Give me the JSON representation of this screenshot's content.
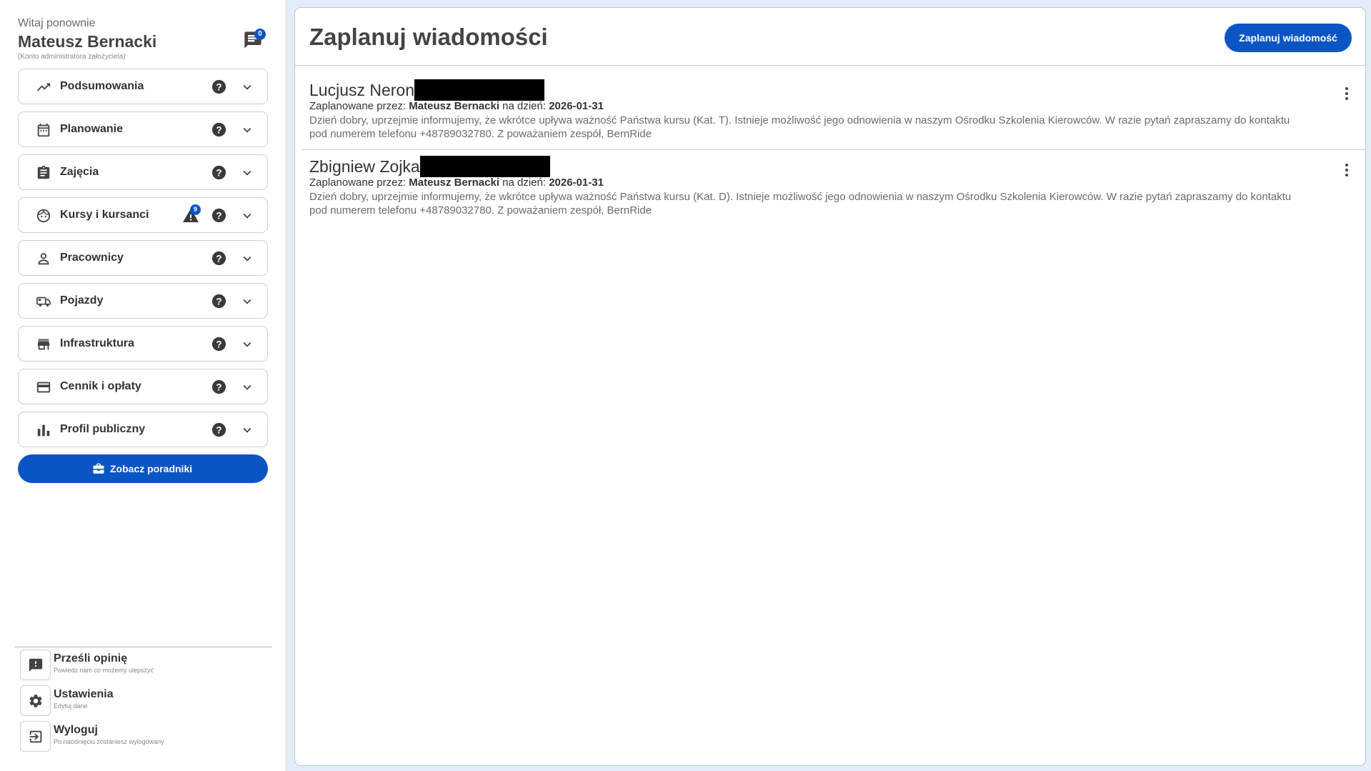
{
  "user": {
    "greeting": "Witaj ponownie",
    "name": "Mateusz Bernacki",
    "account_type": "(Konto administratora założyciela)",
    "messages_count": "0"
  },
  "menu": [
    {
      "label": "Podsumowania",
      "icon": "trending-up-icon"
    },
    {
      "label": "Planowanie",
      "icon": "calendar-icon"
    },
    {
      "label": "Zajęcia",
      "icon": "clipboard-icon"
    },
    {
      "label": "Kursy i kursanci",
      "icon": "face-icon",
      "warning_count": "9"
    },
    {
      "label": "Pracownicy",
      "icon": "person-icon"
    },
    {
      "label": "Pojazdy",
      "icon": "vehicle-icon"
    },
    {
      "label": "Infrastruktura",
      "icon": "store-icon"
    },
    {
      "label": "Cennik i opłaty",
      "icon": "credit-card-icon"
    },
    {
      "label": "Profil publiczny",
      "icon": "bar-chart-icon"
    }
  ],
  "guides_button": "Zobacz poradniki",
  "bottom": [
    {
      "title": "Prześli opinię",
      "subtitle": "Powiedz nam co możemy ulepszyć",
      "icon": "feedback-icon"
    },
    {
      "title": "Ustawienia",
      "subtitle": "Edytuj dane",
      "icon": "gear-icon"
    },
    {
      "title": "Wyloguj",
      "subtitle": "Po naciśnięciu zostaniesz wylogowany",
      "icon": "logout-icon"
    }
  ],
  "main": {
    "title": "Zaplanuj wiadomości",
    "schedule_button": "Zaplanuj wiadomość",
    "scheduled_by_label": "Zaplanowane przez:",
    "on_day_label": "na dzień:",
    "messages": [
      {
        "recipient": "Lucjusz Neron",
        "author": "Mateusz Bernacki",
        "date": "2026-01-31",
        "text": "Dzień dobry, uprzejmie informujemy, że wkrótce upływa ważność Państwa kursu (Kat. T). Istnieje możliwość jego odnowienia w naszym Ośrodku Szkolenia Kierowców. W razie pytań zapraszamy do kontaktu pod numerem telefonu +48789032780. Z poważaniem zespół, BernRide"
      },
      {
        "recipient": "Zbigniew Zojka",
        "author": "Mateusz Bernacki",
        "date": "2026-01-31",
        "text": "Dzień dobry, uprzejmie informujemy, że wkrótce upływa ważność Państwa kursu (Kat. D). Istnieje możliwość jego odnowienia w naszym Ośrodku Szkolenia Kierowców. W razie pytań zapraszamy do kontaktu pod numerem telefonu +48789032780. Z poważaniem zespół, BernRide"
      }
    ]
  },
  "colors": {
    "accent": "#0a55c4",
    "panel_bg": "#e3edf8",
    "border": "#cfcfcf"
  }
}
